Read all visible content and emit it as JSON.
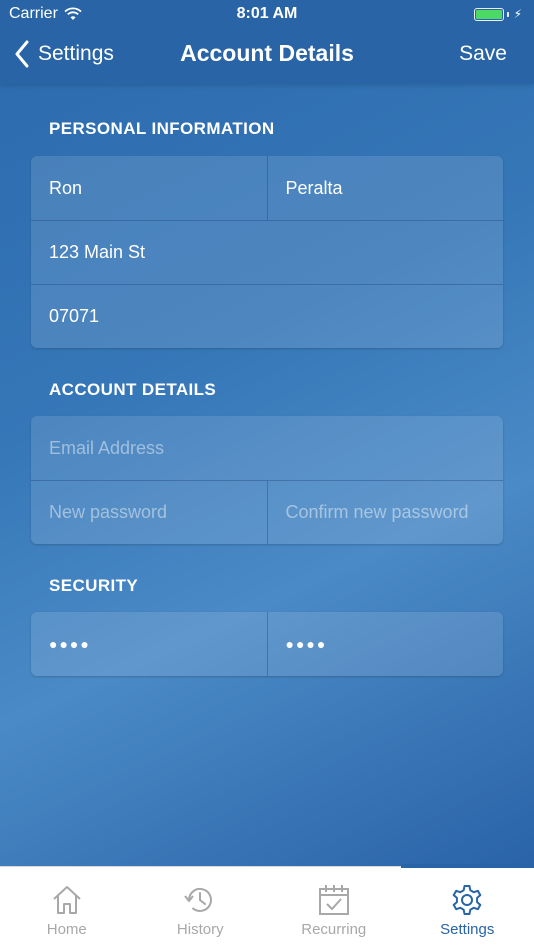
{
  "status_bar": {
    "carrier": "Carrier",
    "time": "8:01 AM",
    "battery_color": "#4cd964"
  },
  "nav": {
    "back_label": "Settings",
    "title": "Account Details",
    "save_label": "Save"
  },
  "personal": {
    "title": "PERSONAL INFORMATION",
    "first_name": "Ron",
    "last_name": "Peralta",
    "address": "123 Main St",
    "zip": "07071"
  },
  "account": {
    "title": "ACCOUNT DETAILS",
    "email_placeholder": "Email Address",
    "new_password_placeholder": "New password",
    "confirm_password_placeholder": "Confirm new password"
  },
  "security": {
    "title": "SECURITY",
    "pin1": "●●●●",
    "pin2": "●●●●"
  },
  "tabs": [
    {
      "label": "Home",
      "icon": "home-icon"
    },
    {
      "label": "History",
      "icon": "history-icon"
    },
    {
      "label": "Recurring",
      "icon": "calendar-check-icon"
    },
    {
      "label": "Settings",
      "icon": "gear-icon",
      "active": true
    }
  ],
  "colors": {
    "accent": "#2864a6",
    "tab_inactive": "#a8a8a8"
  }
}
